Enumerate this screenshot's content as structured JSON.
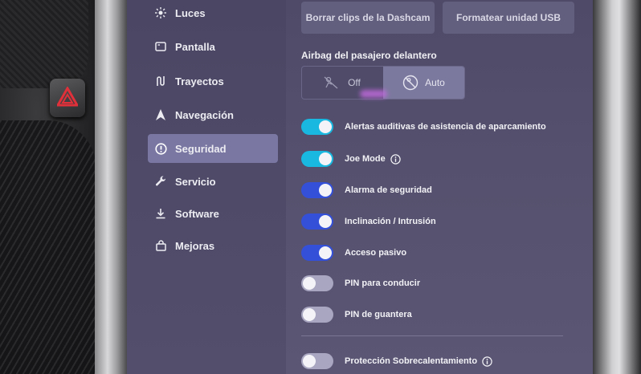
{
  "sidebar": {
    "items": [
      {
        "label": "Luces",
        "icon": "sun-icon"
      },
      {
        "label": "Pantalla",
        "icon": "display-icon"
      },
      {
        "label": "Trayectos",
        "icon": "trips-icon"
      },
      {
        "label": "Navegación",
        "icon": "navigation-icon"
      },
      {
        "label": "Seguridad",
        "icon": "alert-circle-icon",
        "active": true
      },
      {
        "label": "Servicio",
        "icon": "wrench-icon"
      },
      {
        "label": "Software",
        "icon": "download-icon"
      },
      {
        "label": "Mejoras",
        "icon": "shopping-bag-icon"
      }
    ]
  },
  "main": {
    "buttons": {
      "dashcam_label": "Borrar clips de la Dashcam",
      "format_label": "Formatear unidad USB"
    },
    "airbag": {
      "label": "Airbag del pasajero delantero",
      "off_label": "Off",
      "auto_label": "Auto",
      "selected": "Auto"
    },
    "toggles": [
      {
        "label": "Alertas auditivas de asistencia de aparcamiento",
        "on": true,
        "color": "#19b8e0"
      },
      {
        "label": "Joe Mode",
        "on": true,
        "color": "#19b8e0",
        "info": true
      },
      {
        "label": "Alarma de seguridad",
        "on": true,
        "color": "#3450d8"
      },
      {
        "label": "Inclinación / Intrusión",
        "on": true,
        "color": "#3450d8"
      },
      {
        "label": "Acceso pasivo",
        "on": true,
        "color": "#3450d8"
      },
      {
        "label": "PIN para conducir",
        "on": false
      },
      {
        "label": "PIN de guantera",
        "on": false
      },
      {
        "label": "Protección Sobrecalentamiento",
        "on": false,
        "info": true
      }
    ]
  },
  "colors": {
    "accent_cyan": "#19b8e0",
    "accent_blue": "#3450d8",
    "active_nav": "#7a77a3"
  }
}
